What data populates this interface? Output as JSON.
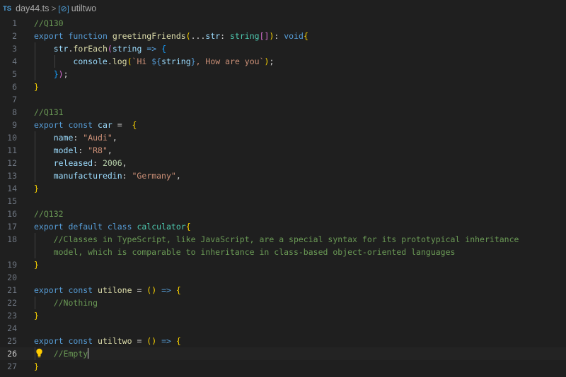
{
  "breadcrumb": {
    "lang_badge": "TS",
    "file": "day44.ts",
    "separator": ">",
    "symbol_icon": "symbol-variable-icon",
    "symbol": "utiltwo"
  },
  "colors": {
    "background": "#1f1f1f",
    "comment": "#6a9955",
    "keyword": "#569cd6",
    "function": "#dcdcaa",
    "variable": "#9cdcfe",
    "string": "#ce9178",
    "number": "#b5cea8",
    "bracket_level_1": "#ffd700",
    "bracket_level_2": "#da70d6",
    "bracket_level_3": "#179fff"
  },
  "editor": {
    "active_line": 26,
    "lines": [
      {
        "n": "1",
        "tokens": [
          [
            "comment",
            "//Q130"
          ]
        ]
      },
      {
        "n": "2",
        "tokens": [
          [
            "keyword",
            "export"
          ],
          [
            "plain",
            " "
          ],
          [
            "keyword",
            "function"
          ],
          [
            "plain",
            " "
          ],
          [
            "func",
            "greetingFriends"
          ],
          [
            "b1",
            "("
          ],
          [
            "plain",
            "..."
          ],
          [
            "var",
            "str"
          ],
          [
            "plain",
            ": "
          ],
          [
            "type",
            "string"
          ],
          [
            "b2",
            "[]"
          ],
          [
            "b1",
            ")"
          ],
          [
            "plain",
            ": "
          ],
          [
            "keyword",
            "void"
          ],
          [
            "b1",
            "{"
          ]
        ]
      },
      {
        "n": "3",
        "tokens": [
          [
            "plain",
            "    "
          ],
          [
            "var",
            "str"
          ],
          [
            "plain",
            "."
          ],
          [
            "func",
            "forEach"
          ],
          [
            "b2",
            "("
          ],
          [
            "var",
            "string"
          ],
          [
            "plain",
            " "
          ],
          [
            "keyword",
            "=>"
          ],
          [
            "plain",
            " "
          ],
          [
            "b3",
            "{"
          ]
        ]
      },
      {
        "n": "4",
        "tokens": [
          [
            "plain",
            "        "
          ],
          [
            "var",
            "console"
          ],
          [
            "plain",
            "."
          ],
          [
            "func",
            "log"
          ],
          [
            "b1",
            "("
          ],
          [
            "string",
            "`Hi "
          ],
          [
            "tpl",
            "${"
          ],
          [
            "var",
            "string"
          ],
          [
            "tpl",
            "}"
          ],
          [
            "string",
            ", How are you`"
          ],
          [
            "b1",
            ")"
          ],
          [
            "plain",
            ";"
          ]
        ]
      },
      {
        "n": "5",
        "tokens": [
          [
            "plain",
            "    "
          ],
          [
            "b3",
            "}"
          ],
          [
            "b2",
            ")"
          ],
          [
            "plain",
            ";"
          ]
        ]
      },
      {
        "n": "6",
        "tokens": [
          [
            "b1",
            "}"
          ]
        ]
      },
      {
        "n": "7",
        "tokens": []
      },
      {
        "n": "8",
        "tokens": [
          [
            "comment",
            "//Q131"
          ]
        ]
      },
      {
        "n": "9",
        "tokens": [
          [
            "keyword",
            "export"
          ],
          [
            "plain",
            " "
          ],
          [
            "keyword",
            "const"
          ],
          [
            "plain",
            " "
          ],
          [
            "var",
            "car"
          ],
          [
            "plain",
            " =  "
          ],
          [
            "b1",
            "{"
          ]
        ]
      },
      {
        "n": "10",
        "tokens": [
          [
            "plain",
            "    "
          ],
          [
            "var",
            "name"
          ],
          [
            "plain",
            ": "
          ],
          [
            "string",
            "\"Audi\""
          ],
          [
            "plain",
            ","
          ]
        ]
      },
      {
        "n": "11",
        "tokens": [
          [
            "plain",
            "    "
          ],
          [
            "var",
            "model"
          ],
          [
            "plain",
            ": "
          ],
          [
            "string",
            "\"R8\""
          ],
          [
            "plain",
            ","
          ]
        ]
      },
      {
        "n": "12",
        "tokens": [
          [
            "plain",
            "    "
          ],
          [
            "var",
            "released"
          ],
          [
            "plain",
            ": "
          ],
          [
            "number",
            "2006"
          ],
          [
            "plain",
            ","
          ]
        ]
      },
      {
        "n": "13",
        "tokens": [
          [
            "plain",
            "    "
          ],
          [
            "var",
            "manufacturedin"
          ],
          [
            "plain",
            ": "
          ],
          [
            "string",
            "\"Germany\""
          ],
          [
            "plain",
            ","
          ]
        ]
      },
      {
        "n": "14",
        "tokens": [
          [
            "b1",
            "}"
          ]
        ]
      },
      {
        "n": "15",
        "tokens": []
      },
      {
        "n": "16",
        "tokens": [
          [
            "comment",
            "//Q132"
          ]
        ]
      },
      {
        "n": "17",
        "tokens": [
          [
            "keyword",
            "export"
          ],
          [
            "plain",
            " "
          ],
          [
            "keyword",
            "default"
          ],
          [
            "plain",
            " "
          ],
          [
            "keyword",
            "class"
          ],
          [
            "plain",
            " "
          ],
          [
            "type",
            "calculator"
          ],
          [
            "b1",
            "{"
          ]
        ]
      },
      {
        "n": "18",
        "tokens": [
          [
            "plain",
            "    "
          ],
          [
            "comment",
            "//Classes in TypeScript, like JavaScript, are a special syntax for its prototypical inheritance"
          ]
        ]
      },
      {
        "n": "",
        "tokens": [
          [
            "plain",
            "    "
          ],
          [
            "comment",
            "model, which is comparable to inheritance in class-based object-oriented languages"
          ]
        ]
      },
      {
        "n": "19",
        "tokens": [
          [
            "b1",
            "}"
          ]
        ]
      },
      {
        "n": "20",
        "tokens": []
      },
      {
        "n": "21",
        "tokens": [
          [
            "keyword",
            "export"
          ],
          [
            "plain",
            " "
          ],
          [
            "keyword",
            "const"
          ],
          [
            "plain",
            " "
          ],
          [
            "func",
            "utilone"
          ],
          [
            "plain",
            " = "
          ],
          [
            "b1",
            "()"
          ],
          [
            "plain",
            " "
          ],
          [
            "keyword",
            "=>"
          ],
          [
            "plain",
            " "
          ],
          [
            "b1",
            "{"
          ]
        ]
      },
      {
        "n": "22",
        "tokens": [
          [
            "plain",
            "    "
          ],
          [
            "comment",
            "//Nothing"
          ]
        ]
      },
      {
        "n": "23",
        "tokens": [
          [
            "b1",
            "}"
          ]
        ]
      },
      {
        "n": "24",
        "tokens": []
      },
      {
        "n": "25",
        "tokens": [
          [
            "keyword",
            "export"
          ],
          [
            "plain",
            " "
          ],
          [
            "keyword",
            "const"
          ],
          [
            "plain",
            " "
          ],
          [
            "func",
            "utiltwo"
          ],
          [
            "plain",
            " = "
          ],
          [
            "b1",
            "()"
          ],
          [
            "plain",
            " "
          ],
          [
            "keyword",
            "=>"
          ],
          [
            "plain",
            " "
          ],
          [
            "b1",
            "{"
          ]
        ]
      },
      {
        "n": "26",
        "tokens": [
          [
            "plain",
            "    "
          ],
          [
            "comment",
            "//Empty"
          ]
        ]
      },
      {
        "n": "27",
        "tokens": [
          [
            "b1",
            "}"
          ]
        ]
      }
    ]
  }
}
